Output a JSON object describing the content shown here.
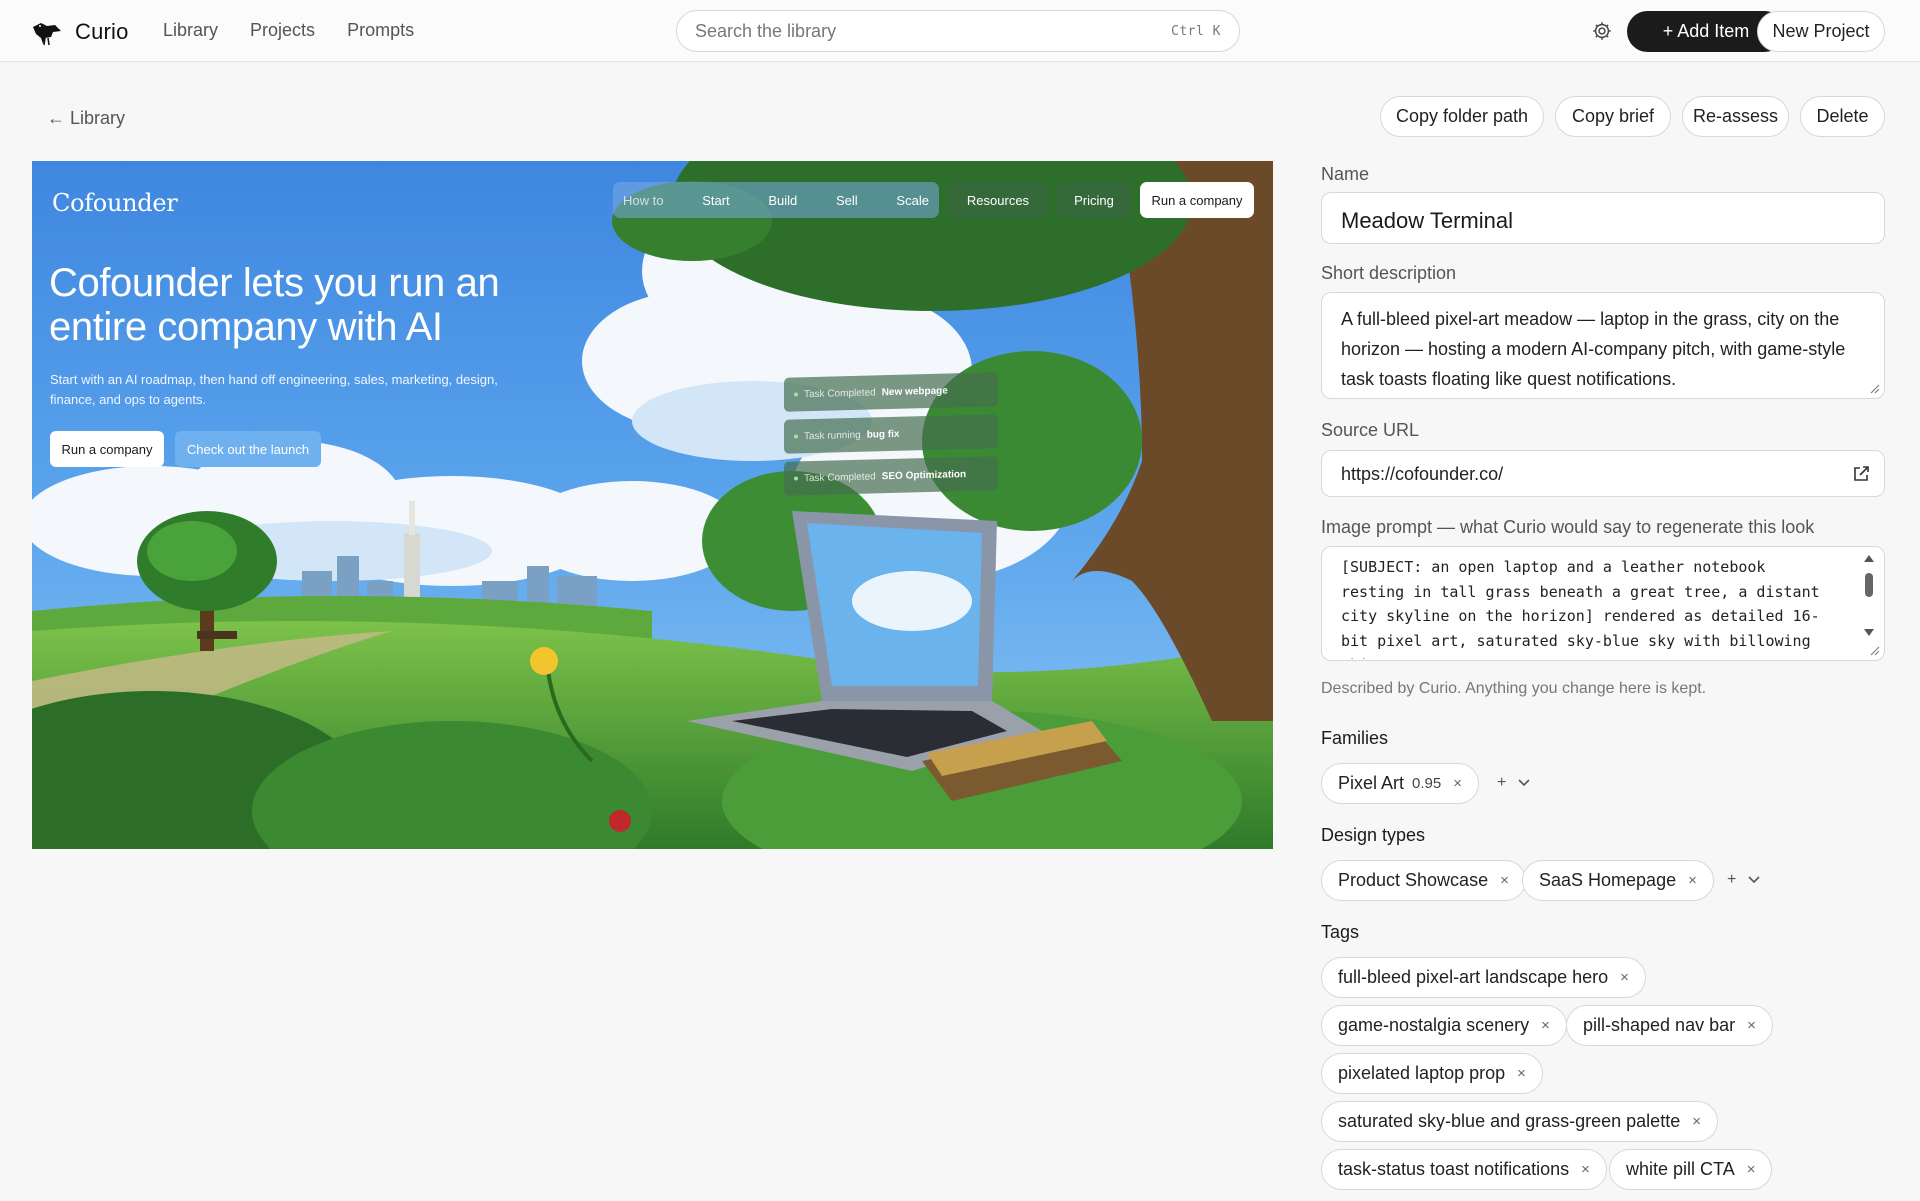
{
  "app": {
    "name": "Curio",
    "nav": [
      "Library",
      "Projects",
      "Prompts"
    ],
    "search_placeholder": "Search the library",
    "search_shortcut": "Ctrl K",
    "add_item": "+ Add Item",
    "new_project": "New Project"
  },
  "toolbar": {
    "back": "← Library",
    "copy_folder_path": "Copy folder path",
    "copy_brief": "Copy brief",
    "reassess": "Re-assess",
    "delete": "Delete"
  },
  "preview": {
    "brand": "Cofounder",
    "nav_group": [
      "How to",
      "Start",
      "Build",
      "Sell",
      "Scale"
    ],
    "nav_resources": "Resources",
    "nav_pricing": "Pricing",
    "nav_cta": "Run a company",
    "headline": "Cofounder lets you run an entire company with AI",
    "subhead": "Start with an AI roadmap, then hand off engineering, sales, marketing, design, finance, and ops to agents.",
    "cta_primary": "Run a company",
    "cta_secondary": "Check out the launch",
    "toasts": [
      {
        "status": "Task Completed",
        "task": "New webpage"
      },
      {
        "status": "Task running",
        "task": "bug fix"
      },
      {
        "status": "Task Completed",
        "task": "SEO Optimization"
      }
    ]
  },
  "form": {
    "name_label": "Name",
    "name_value": "Meadow Terminal",
    "desc_label": "Short description",
    "desc_value": "A full-bleed pixel-art meadow — laptop in the grass, city on the horizon — hosting a modern AI-company pitch, with game-style task toasts floating like quest notifications.",
    "url_label": "Source URL",
    "url_value": "https://cofounder.co/",
    "prompt_label": "Image prompt — what Curio would say to regenerate this look",
    "prompt_value": "[SUBJECT: an open laptop and a leather notebook resting in tall grass beneath a great tree, a distant city skyline on the horizon] rendered as detailed 16-bit pixel art, saturated sky-blue sky with billowing white",
    "hint": "Described by Curio. Anything you change here is kept.",
    "families_label": "Families",
    "families": [
      {
        "name": "Pixel Art",
        "score": "0.95"
      }
    ],
    "design_types_label": "Design types",
    "design_types": [
      "Product Showcase",
      "SaaS Homepage"
    ],
    "tags_label": "Tags",
    "tags": [
      "full-bleed pixel-art landscape hero",
      "game-nostalgia scenery",
      "pill-shaped nav bar",
      "pixelated laptop prop",
      "saturated sky-blue and grass-green palette",
      "task-status toast notifications",
      "white pill CTA"
    ],
    "add_symbol": "+",
    "remove_symbol": "×"
  }
}
